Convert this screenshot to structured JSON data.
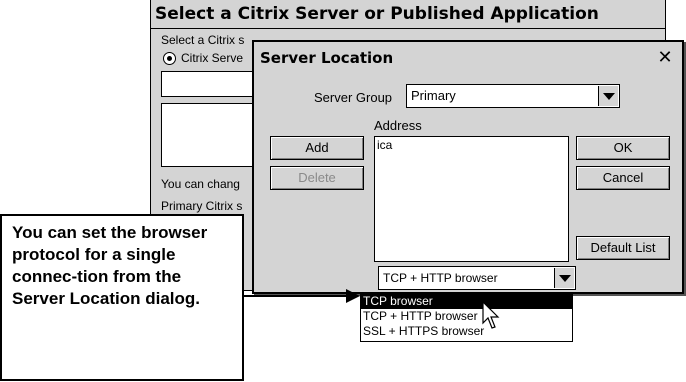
{
  "background_window": {
    "title": "Select a Citrix Server or Published Application",
    "instruction": "Select a Citrix s",
    "radio_label": "Citrix Serve",
    "info_text": "You can chang",
    "primary_text": "Primary Citrix s"
  },
  "dialog": {
    "title": "Server Location",
    "server_group_label": "Server Group",
    "server_group_value": "Primary",
    "address_label": "Address",
    "address_entries": [
      "ica"
    ],
    "buttons": {
      "add": "Add",
      "delete": "Delete",
      "ok": "OK",
      "cancel": "Cancel",
      "default_list": "Default List"
    },
    "protocol_selected": "TCP + HTTP browser",
    "protocol_options": [
      "TCP browser",
      "TCP + HTTP browser",
      "SSL + HTTPS browser"
    ],
    "highlighted_option": "TCP browser"
  },
  "callout": {
    "text": "You can set the browser protocol for a single connec-tion from the Server Location dialog."
  }
}
